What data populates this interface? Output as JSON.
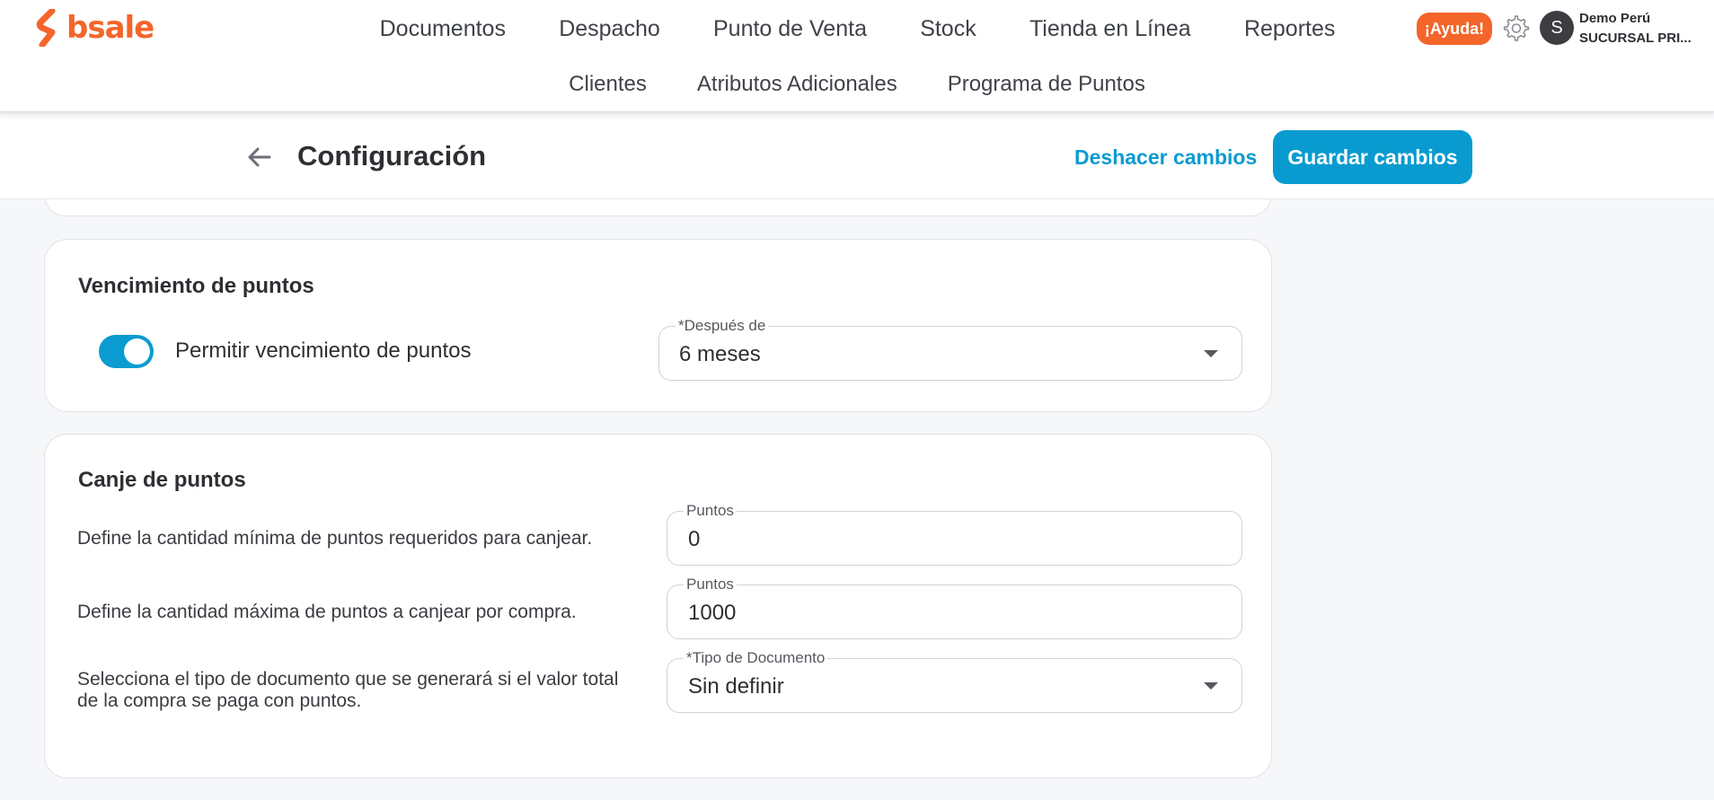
{
  "brand": {
    "name": "bsale",
    "color": "#f4652a"
  },
  "main_nav": [
    "Documentos",
    "Despacho",
    "Punto de Venta",
    "Stock",
    "Tienda en Línea",
    "Reportes"
  ],
  "help_label": "¡Ayuda!",
  "user": {
    "initial": "S",
    "name": "Demo Perú",
    "branch": "SUCURSAL PRI..."
  },
  "sub_nav": [
    "Clientes",
    "Atributos Adicionales",
    "Programa de Puntos"
  ],
  "header": {
    "title": "Configuración",
    "undo_label": "Deshacer cambios",
    "save_label": "Guardar cambios"
  },
  "expiration": {
    "title": "Vencimiento de puntos",
    "toggle_label": "Permitir vencimiento de puntos",
    "toggle_on": true,
    "after_label": "*Después de",
    "after_value": "6 meses"
  },
  "redeem": {
    "title": "Canje de puntos",
    "rows": [
      {
        "description": "Define la cantidad mínima de puntos requeridos para canjear.",
        "field_label": "Puntos",
        "value": "0"
      },
      {
        "description": "Define la cantidad máxima de puntos a canjear por compra.",
        "field_label": "Puntos",
        "value": "1000"
      }
    ],
    "doc_description_1": "Selecciona el tipo de documento que se generará si el valor total",
    "doc_description_2": "de la compra se paga con puntos.",
    "doc_field_label": "*Tipo de Documento",
    "doc_value": "Sin definir"
  },
  "colors": {
    "accent": "#0a9bd0",
    "help": "#f4652a"
  }
}
